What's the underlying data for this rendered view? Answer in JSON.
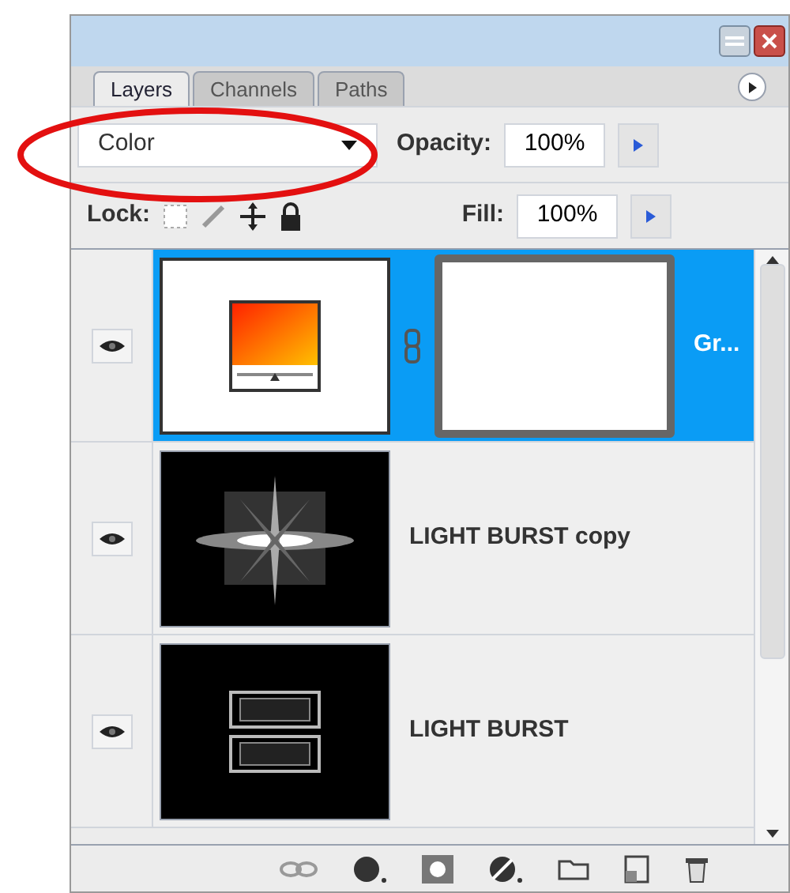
{
  "tabs": [
    {
      "label": "Layers",
      "selected": true
    },
    {
      "label": "Channels",
      "selected": false
    },
    {
      "label": "Paths",
      "selected": false
    }
  ],
  "blend_mode": "Color",
  "opacity": {
    "label": "Opacity:",
    "value": "100%"
  },
  "lock": {
    "label": "Lock:"
  },
  "fill": {
    "label": "Fill:",
    "value": "100%"
  },
  "layers": [
    {
      "name": "Gr...",
      "kind": "gradient",
      "visible": true,
      "selected": true
    },
    {
      "name": "LIGHT BURST copy",
      "kind": "burst",
      "visible": true,
      "selected": false
    },
    {
      "name": "LIGHT BURST",
      "kind": "text",
      "visible": true,
      "selected": false
    }
  ]
}
